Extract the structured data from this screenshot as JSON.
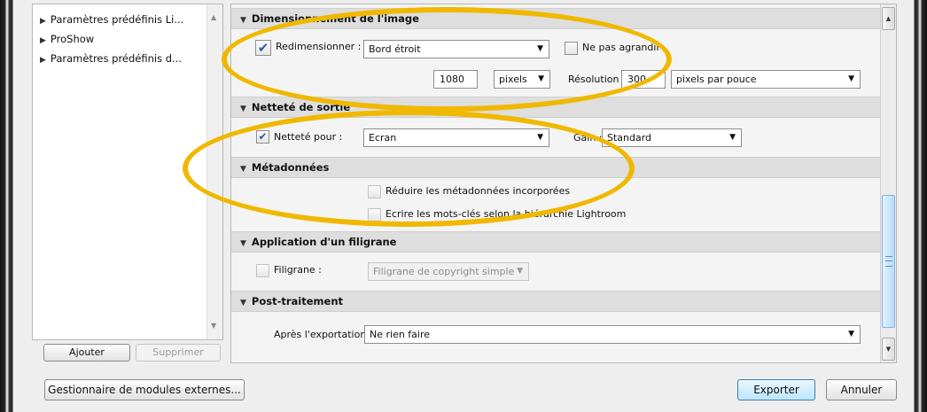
{
  "presets": {
    "items": [
      {
        "label": "Paramètres prédéfinis Li..."
      },
      {
        "label": "ProShow"
      },
      {
        "label": "Paramètres prédéfinis d..."
      }
    ],
    "add_label": "Ajouter",
    "remove_label": "Supprimer"
  },
  "sections": {
    "resize": {
      "title": "Dimensionnement de l'image",
      "resize_label": "Redimensionner :",
      "resize_value": "Bord étroit",
      "dont_enlarge_label": "Ne pas agrandir",
      "size_value": "1080",
      "size_unit": "pixels",
      "resolution_label": "Résolution :",
      "resolution_value": "300",
      "resolution_unit": "pixels par pouce"
    },
    "sharpening": {
      "title": "Netteté de sortie",
      "sharpen_label": "Netteté pour :",
      "sharpen_value": "Ecran",
      "gain_label": "Gain :",
      "gain_value": "Standard"
    },
    "metadata": {
      "title": "Métadonnées",
      "reduce_label": "Réduire les métadonnées incorporées",
      "keywords_label": "Ecrire les mots-clés selon la hiérarchie Lightroom"
    },
    "watermark": {
      "title": "Application d'un filigrane",
      "watermark_label": "Filigrane :",
      "watermark_value": "Filigrane de copyright simple"
    },
    "postprocess": {
      "title": "Post-traitement",
      "after_export_label": "Après l'exportation :",
      "after_export_value": "Ne rien faire"
    }
  },
  "footer": {
    "plugin_manager_label": "Gestionnaire de modules externes...",
    "export_label": "Exporter",
    "cancel_label": "Annuler"
  },
  "colors": {
    "highlight": "#f0b800",
    "check": "#2a5da8"
  }
}
